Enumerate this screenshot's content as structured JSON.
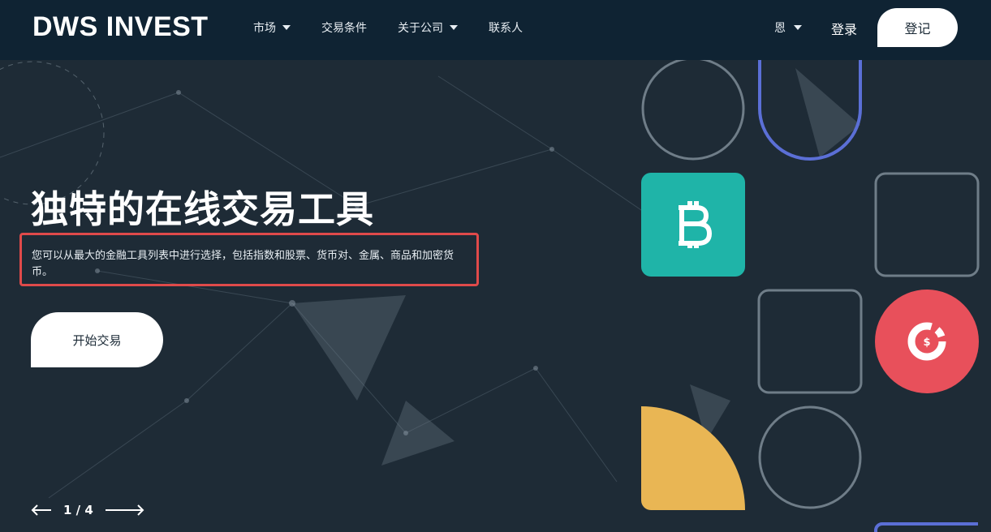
{
  "header": {
    "brand": "DWS INVEST",
    "nav": [
      {
        "label": "市场",
        "has_caret": true
      },
      {
        "label": "交易条件",
        "has_caret": false
      },
      {
        "label": "关于公司",
        "has_caret": true
      },
      {
        "label": "联系人",
        "has_caret": false
      }
    ],
    "language": "恩",
    "login_label": "登录",
    "register_label": "登记"
  },
  "hero": {
    "title": "独特的在线交易工具",
    "subtitle": "您可以从最大的金融工具列表中进行选择，包括指数和股票、货币对、金属、商品和加密货币。",
    "cta_label": "开始交易",
    "pager": "1 / 4"
  },
  "icons": {
    "bitcoin": "bitcoin-icon",
    "dollar_chart": "dollar-pie-icon",
    "prev": "arrow-left-icon",
    "next": "arrow-right-icon"
  },
  "colors": {
    "header_bg": "#0f2333",
    "hero_bg": "#1e2b36",
    "bitcoin_tile": "#1fb4a8",
    "dollar_circle": "#e8505b",
    "yellow_shape": "#e9b654",
    "blue_outline": "#5b6fd6",
    "highlight_border": "#e04a4a"
  }
}
